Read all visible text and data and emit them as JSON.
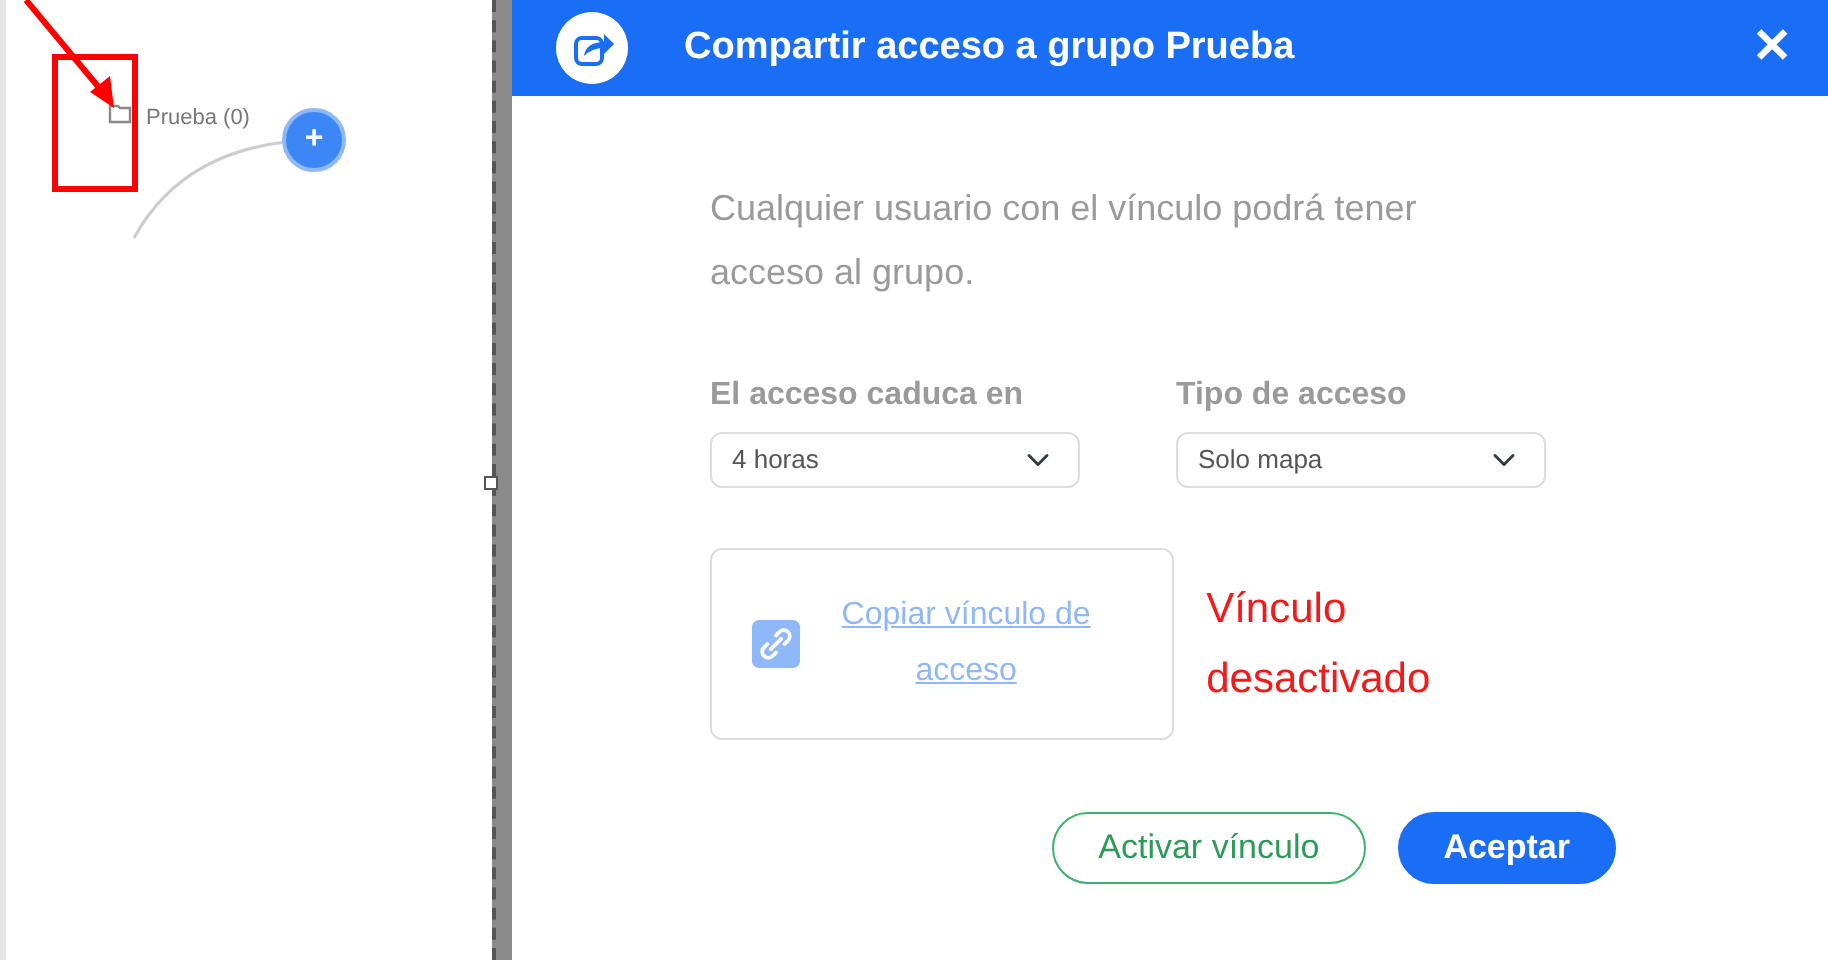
{
  "canvas": {
    "node": {
      "label": "Prueba (0)"
    },
    "add_button": {
      "label": "+"
    }
  },
  "dialog": {
    "title": "Compartir acceso a grupo Prueba",
    "close": "✕",
    "description": "Cualquier usuario con el vínculo podrá tener acceso al grupo.",
    "fields": [
      {
        "label": "El acceso caduca en",
        "value": "4 horas"
      },
      {
        "label": "Tipo de acceso",
        "value": "Solo mapa"
      }
    ],
    "link": {
      "label": "Copiar vínculo de acceso",
      "enabled": false
    },
    "link_status": "Vínculo desactivado",
    "buttons": [
      {
        "label": "Activar vínculo",
        "kind": "outline"
      },
      {
        "label": "Aceptar",
        "kind": "primary"
      }
    ]
  }
}
